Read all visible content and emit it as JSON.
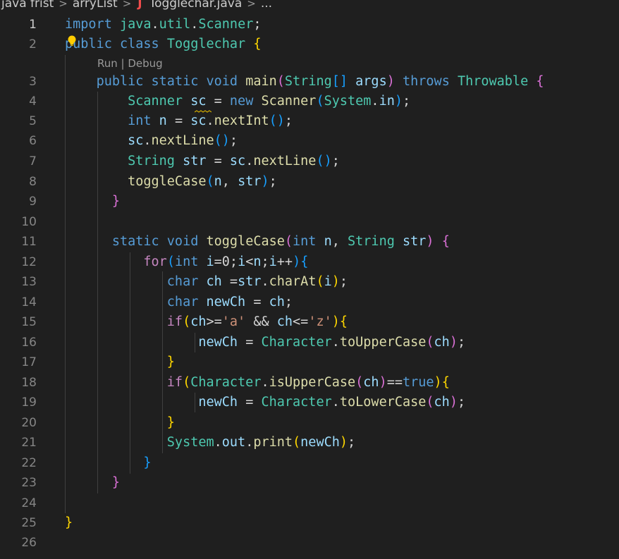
{
  "breadcrumb": {
    "items": [
      "java frist",
      "arryList",
      "Togglechar.java",
      "..."
    ],
    "java_icon_letter": "J",
    "separator": ">"
  },
  "codelens": {
    "run": "Run",
    "separator": " | ",
    "debug": "Debug"
  },
  "editor": {
    "active_line": 1,
    "lines": [
      {
        "n": "1",
        "tokens": [
          [
            "kw",
            "import"
          ],
          [
            "plain",
            " "
          ],
          [
            "typ",
            "java"
          ],
          [
            "plain",
            "."
          ],
          [
            "typ",
            "util"
          ],
          [
            "plain",
            "."
          ],
          [
            "typ",
            "Scanner"
          ],
          [
            "plain",
            ";"
          ]
        ]
      },
      {
        "n": "2",
        "tokens": [
          [
            "kw",
            "public"
          ],
          [
            "plain",
            " "
          ],
          [
            "kw",
            "class"
          ],
          [
            "plain",
            " "
          ],
          [
            "typ",
            "Togglechar"
          ],
          [
            "plain",
            " "
          ],
          [
            "b1",
            "{"
          ]
        ]
      },
      {
        "n": "3",
        "tokens": [
          [
            "plain",
            "    "
          ],
          [
            "kw",
            "public"
          ],
          [
            "plain",
            " "
          ],
          [
            "kw",
            "static"
          ],
          [
            "plain",
            " "
          ],
          [
            "kw",
            "void"
          ],
          [
            "plain",
            " "
          ],
          [
            "fn",
            "main"
          ],
          [
            "b2",
            "("
          ],
          [
            "typ",
            "String"
          ],
          [
            "b3",
            "[]"
          ],
          [
            "plain",
            " "
          ],
          [
            "var",
            "args"
          ],
          [
            "b2",
            ")"
          ],
          [
            "plain",
            " "
          ],
          [
            "kw",
            "throws"
          ],
          [
            "plain",
            " "
          ],
          [
            "typ",
            "Throwable"
          ],
          [
            "plain",
            " "
          ],
          [
            "b2",
            "{"
          ]
        ]
      },
      {
        "n": "4",
        "tokens": [
          [
            "plain",
            "        "
          ],
          [
            "typ",
            "Scanner"
          ],
          [
            "plain",
            " "
          ],
          [
            "var",
            "sc"
          ],
          [
            "plain",
            " = "
          ],
          [
            "kw",
            "new"
          ],
          [
            "plain",
            " "
          ],
          [
            "fn",
            "Scanner"
          ],
          [
            "b3",
            "("
          ],
          [
            "typ",
            "System"
          ],
          [
            "plain",
            "."
          ],
          [
            "var",
            "in"
          ],
          [
            "b3",
            ")"
          ],
          [
            "plain",
            ";"
          ]
        ]
      },
      {
        "n": "5",
        "tokens": [
          [
            "plain",
            "        "
          ],
          [
            "kw",
            "int"
          ],
          [
            "plain",
            " "
          ],
          [
            "var",
            "n"
          ],
          [
            "plain",
            " = "
          ],
          [
            "var",
            "sc"
          ],
          [
            "plain",
            "."
          ],
          [
            "fn",
            "nextInt"
          ],
          [
            "b3",
            "()"
          ],
          [
            "plain",
            ";"
          ]
        ]
      },
      {
        "n": "6",
        "tokens": [
          [
            "plain",
            "        "
          ],
          [
            "var",
            "sc"
          ],
          [
            "plain",
            "."
          ],
          [
            "fn",
            "nextLine"
          ],
          [
            "b3",
            "()"
          ],
          [
            "plain",
            ";"
          ]
        ]
      },
      {
        "n": "7",
        "tokens": [
          [
            "plain",
            "        "
          ],
          [
            "typ",
            "String"
          ],
          [
            "plain",
            " "
          ],
          [
            "var",
            "str"
          ],
          [
            "plain",
            " = "
          ],
          [
            "var",
            "sc"
          ],
          [
            "plain",
            "."
          ],
          [
            "fn",
            "nextLine"
          ],
          [
            "b3",
            "()"
          ],
          [
            "plain",
            ";"
          ]
        ]
      },
      {
        "n": "8",
        "tokens": [
          [
            "plain",
            "        "
          ],
          [
            "fn",
            "toggleCase"
          ],
          [
            "b3",
            "("
          ],
          [
            "var",
            "n"
          ],
          [
            "plain",
            ", "
          ],
          [
            "var",
            "str"
          ],
          [
            "b3",
            ")"
          ],
          [
            "plain",
            ";"
          ]
        ]
      },
      {
        "n": "9",
        "tokens": [
          [
            "plain",
            "      "
          ],
          [
            "b2",
            "}"
          ]
        ]
      },
      {
        "n": "10",
        "tokens": []
      },
      {
        "n": "11",
        "tokens": [
          [
            "plain",
            "      "
          ],
          [
            "kw",
            "static"
          ],
          [
            "plain",
            " "
          ],
          [
            "kw",
            "void"
          ],
          [
            "plain",
            " "
          ],
          [
            "fn",
            "toggleCase"
          ],
          [
            "b2",
            "("
          ],
          [
            "kw",
            "int"
          ],
          [
            "plain",
            " "
          ],
          [
            "var",
            "n"
          ],
          [
            "plain",
            ", "
          ],
          [
            "typ",
            "String"
          ],
          [
            "plain",
            " "
          ],
          [
            "var",
            "str"
          ],
          [
            "b2",
            ")"
          ],
          [
            "plain",
            " "
          ],
          [
            "b2",
            "{"
          ]
        ]
      },
      {
        "n": "12",
        "tokens": [
          [
            "plain",
            "          "
          ],
          [
            "ctl",
            "for"
          ],
          [
            "b3",
            "("
          ],
          [
            "kw",
            "int"
          ],
          [
            "plain",
            " "
          ],
          [
            "var",
            "i"
          ],
          [
            "plain",
            "=0;"
          ],
          [
            "var",
            "i"
          ],
          [
            "plain",
            "<"
          ],
          [
            "var",
            "n"
          ],
          [
            "plain",
            ";"
          ],
          [
            "var",
            "i"
          ],
          [
            "plain",
            "++"
          ],
          [
            "b3",
            ")"
          ],
          [
            "b3",
            "{"
          ]
        ]
      },
      {
        "n": "13",
        "tokens": [
          [
            "plain",
            "             "
          ],
          [
            "kw",
            "char"
          ],
          [
            "plain",
            " "
          ],
          [
            "var",
            "ch"
          ],
          [
            "plain",
            " ="
          ],
          [
            "var",
            "str"
          ],
          [
            "plain",
            "."
          ],
          [
            "fn",
            "charAt"
          ],
          [
            "b1",
            "("
          ],
          [
            "var",
            "i"
          ],
          [
            "b1",
            ")"
          ],
          [
            "plain",
            ";"
          ]
        ]
      },
      {
        "n": "14",
        "tokens": [
          [
            "plain",
            "             "
          ],
          [
            "kw",
            "char"
          ],
          [
            "plain",
            " "
          ],
          [
            "var",
            "newCh"
          ],
          [
            "plain",
            " = "
          ],
          [
            "var",
            "ch"
          ],
          [
            "plain",
            ";"
          ]
        ]
      },
      {
        "n": "15",
        "tokens": [
          [
            "plain",
            "             "
          ],
          [
            "ctl",
            "if"
          ],
          [
            "b1",
            "("
          ],
          [
            "var",
            "ch"
          ],
          [
            "plain",
            ">="
          ],
          [
            "str",
            "'a'"
          ],
          [
            "plain",
            " && "
          ],
          [
            "var",
            "ch"
          ],
          [
            "plain",
            "<="
          ],
          [
            "str",
            "'z'"
          ],
          [
            "b1",
            ")"
          ],
          [
            "b1",
            "{"
          ]
        ]
      },
      {
        "n": "16",
        "tokens": [
          [
            "plain",
            "                 "
          ],
          [
            "var",
            "newCh"
          ],
          [
            "plain",
            " = "
          ],
          [
            "typ",
            "Character"
          ],
          [
            "plain",
            "."
          ],
          [
            "fn",
            "toUpperCase"
          ],
          [
            "b2",
            "("
          ],
          [
            "var",
            "ch"
          ],
          [
            "b2",
            ")"
          ],
          [
            "plain",
            ";"
          ]
        ]
      },
      {
        "n": "17",
        "tokens": [
          [
            "plain",
            "             "
          ],
          [
            "b1",
            "}"
          ]
        ]
      },
      {
        "n": "18",
        "tokens": [
          [
            "plain",
            "             "
          ],
          [
            "ctl",
            "if"
          ],
          [
            "b1",
            "("
          ],
          [
            "typ",
            "Character"
          ],
          [
            "plain",
            "."
          ],
          [
            "fn",
            "isUpperCase"
          ],
          [
            "b2",
            "("
          ],
          [
            "var",
            "ch"
          ],
          [
            "b2",
            ")"
          ],
          [
            "plain",
            "=="
          ],
          [
            "kw",
            "true"
          ],
          [
            "b1",
            ")"
          ],
          [
            "b1",
            "{"
          ]
        ]
      },
      {
        "n": "19",
        "tokens": [
          [
            "plain",
            "                 "
          ],
          [
            "var",
            "newCh"
          ],
          [
            "plain",
            " = "
          ],
          [
            "typ",
            "Character"
          ],
          [
            "plain",
            "."
          ],
          [
            "fn",
            "toLowerCase"
          ],
          [
            "b2",
            "("
          ],
          [
            "var",
            "ch"
          ],
          [
            "b2",
            ")"
          ],
          [
            "plain",
            ";"
          ]
        ]
      },
      {
        "n": "20",
        "tokens": [
          [
            "plain",
            "             "
          ],
          [
            "b1",
            "}"
          ]
        ]
      },
      {
        "n": "21",
        "tokens": [
          [
            "plain",
            "             "
          ],
          [
            "typ",
            "System"
          ],
          [
            "plain",
            "."
          ],
          [
            "var",
            "out"
          ],
          [
            "plain",
            "."
          ],
          [
            "fn",
            "print"
          ],
          [
            "b1",
            "("
          ],
          [
            "var",
            "newCh"
          ],
          [
            "b1",
            ")"
          ],
          [
            "plain",
            ";"
          ]
        ]
      },
      {
        "n": "22",
        "tokens": [
          [
            "plain",
            "          "
          ],
          [
            "b3",
            "}"
          ]
        ]
      },
      {
        "n": "23",
        "tokens": [
          [
            "plain",
            "      "
          ],
          [
            "b2",
            "}"
          ]
        ]
      },
      {
        "n": "24",
        "tokens": []
      },
      {
        "n": "25",
        "tokens": [
          [
            "b1",
            "}"
          ]
        ]
      },
      {
        "n": "26",
        "tokens": []
      }
    ]
  }
}
